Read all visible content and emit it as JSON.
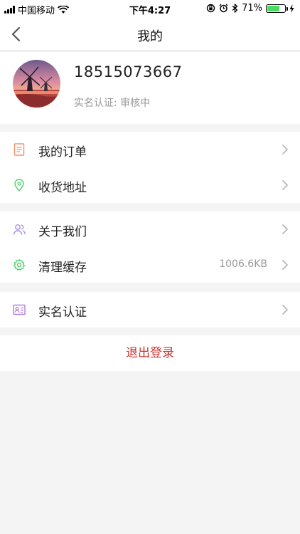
{
  "status_bar": {
    "carrier": "中国移动",
    "time": "下午4:27",
    "battery_percent": "71%",
    "battery_level": 0.71,
    "icons": [
      "signal-icon",
      "wifi-icon",
      "orientation-lock-icon",
      "alarm-icon",
      "bluetooth-icon",
      "battery-icon",
      "charging-icon"
    ]
  },
  "nav": {
    "title": "我的",
    "back_icon": "chevron-left-icon"
  },
  "profile": {
    "phone": "18515073667",
    "verify_status": "实名认证: 审核中"
  },
  "menu": {
    "orders": {
      "label": "我的订单",
      "icon": "document-icon"
    },
    "address": {
      "label": "收货地址",
      "icon": "location-pin-icon"
    },
    "about": {
      "label": "关于我们",
      "icon": "users-icon"
    },
    "cache": {
      "label": "清理缓存",
      "value": "1006.6KB",
      "icon": "gear-icon"
    },
    "realname": {
      "label": "实名认证",
      "icon": "id-card-icon"
    }
  },
  "logout_label": "退出登录",
  "colors": {
    "background": "#f4f4f4",
    "accent_red": "#d0312d",
    "orders_icon": "#f0926a",
    "address_icon": "#4cd06a",
    "about_icon": "#a98be0",
    "cache_icon": "#4cd06a",
    "realname_icon": "#b07de0"
  }
}
